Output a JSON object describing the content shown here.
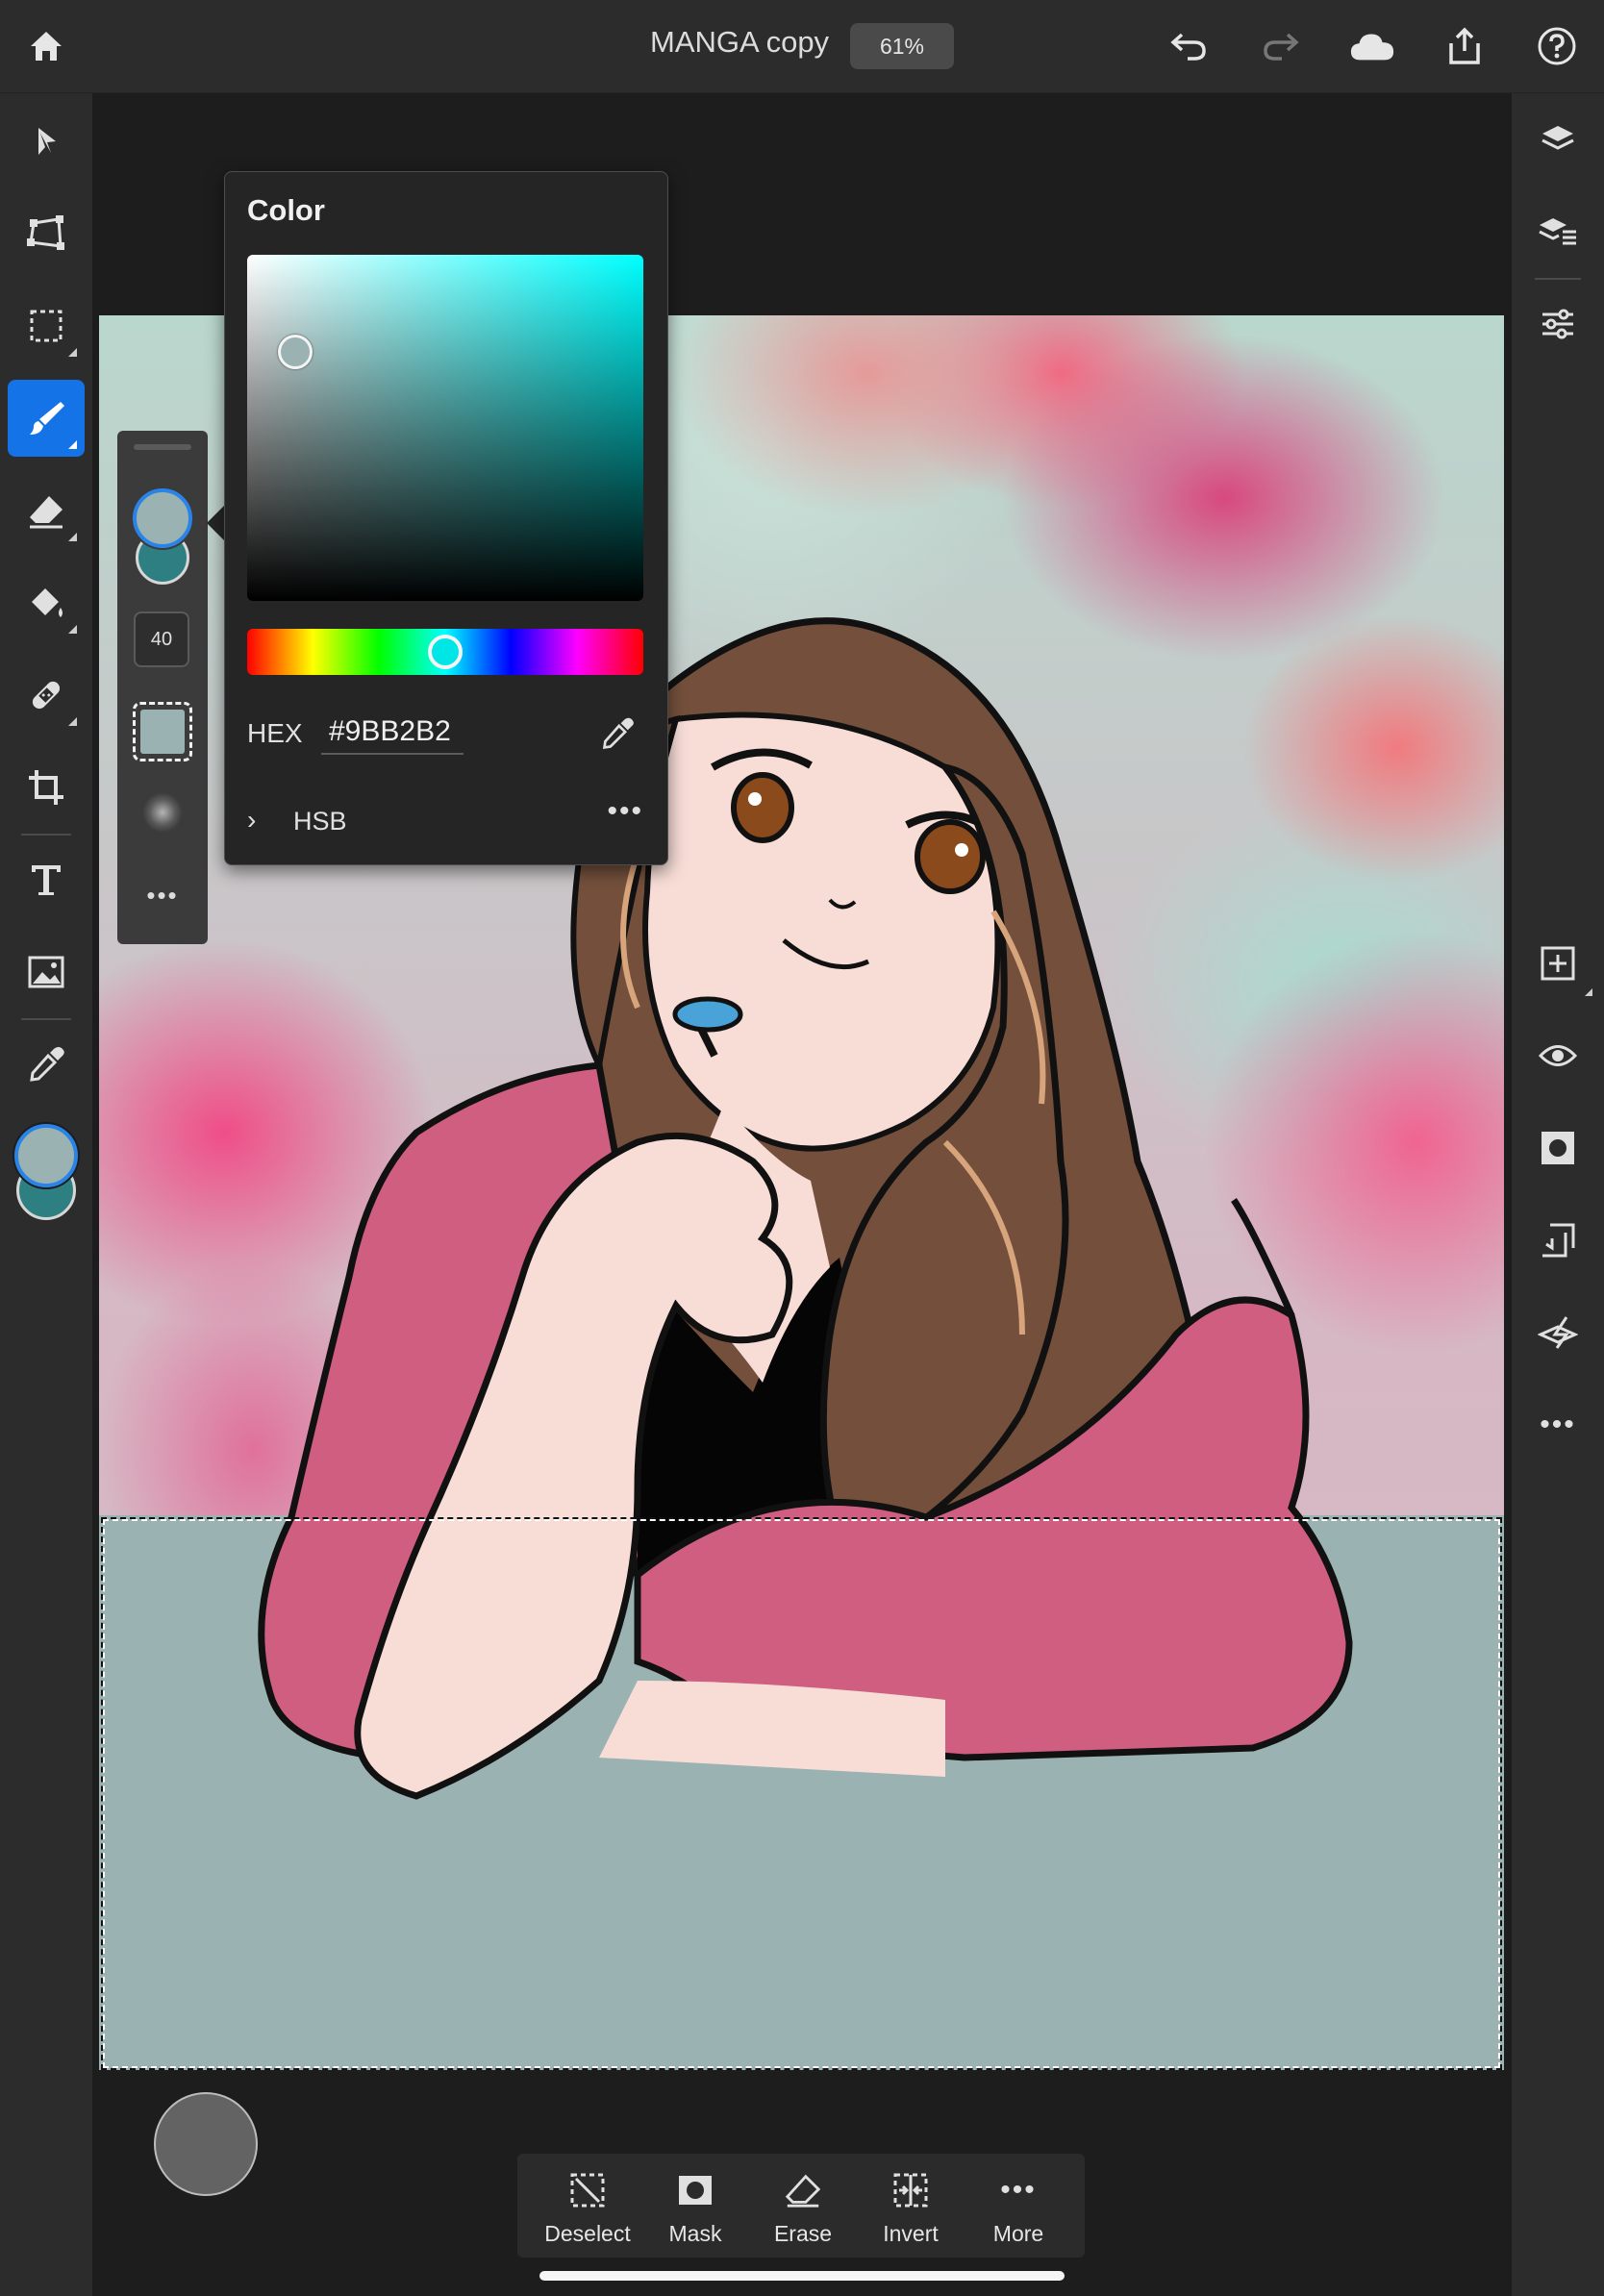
{
  "topbar": {
    "document_title": "MANGA copy",
    "zoom": "61%",
    "icons": [
      "home-icon",
      "undo-icon",
      "redo-icon",
      "cloud-icon",
      "share-icon",
      "help-icon"
    ]
  },
  "left_toolbar": {
    "tools": [
      "select-icon",
      "transform-icon",
      "marquee-icon",
      "brush-icon",
      "eraser-icon",
      "fill-icon",
      "healing-icon",
      "crop-icon",
      "type-icon",
      "image-icon",
      "eyedropper-icon"
    ],
    "active_tool": "brush-icon"
  },
  "brush_panel": {
    "size": "40"
  },
  "color_popover": {
    "title": "Color",
    "hex_label": "HEX",
    "hex_value": "#9BB2B2",
    "mode_label": "HSB",
    "hue_fraction": 0.5
  },
  "colors": {
    "primary": "#9BB2B2",
    "secondary": "#2e7f82",
    "accent": "#1473e6",
    "selection_fill": "#9bb2b2"
  },
  "right_toolbar": {
    "icons": [
      "layers-icon",
      "layer-properties-icon",
      "adjustments-icon",
      "add-layer-icon",
      "visibility-icon",
      "mask-icon",
      "clipping-icon",
      "merge-icon",
      "more-icon"
    ]
  },
  "taskbar": {
    "items": [
      {
        "label": "Deselect",
        "icon": "deselect-icon"
      },
      {
        "label": "Mask",
        "icon": "mask-icon"
      },
      {
        "label": "Erase",
        "icon": "erase-icon"
      },
      {
        "label": "Invert",
        "icon": "invert-icon"
      },
      {
        "label": "More",
        "icon": "more-icon"
      }
    ]
  }
}
